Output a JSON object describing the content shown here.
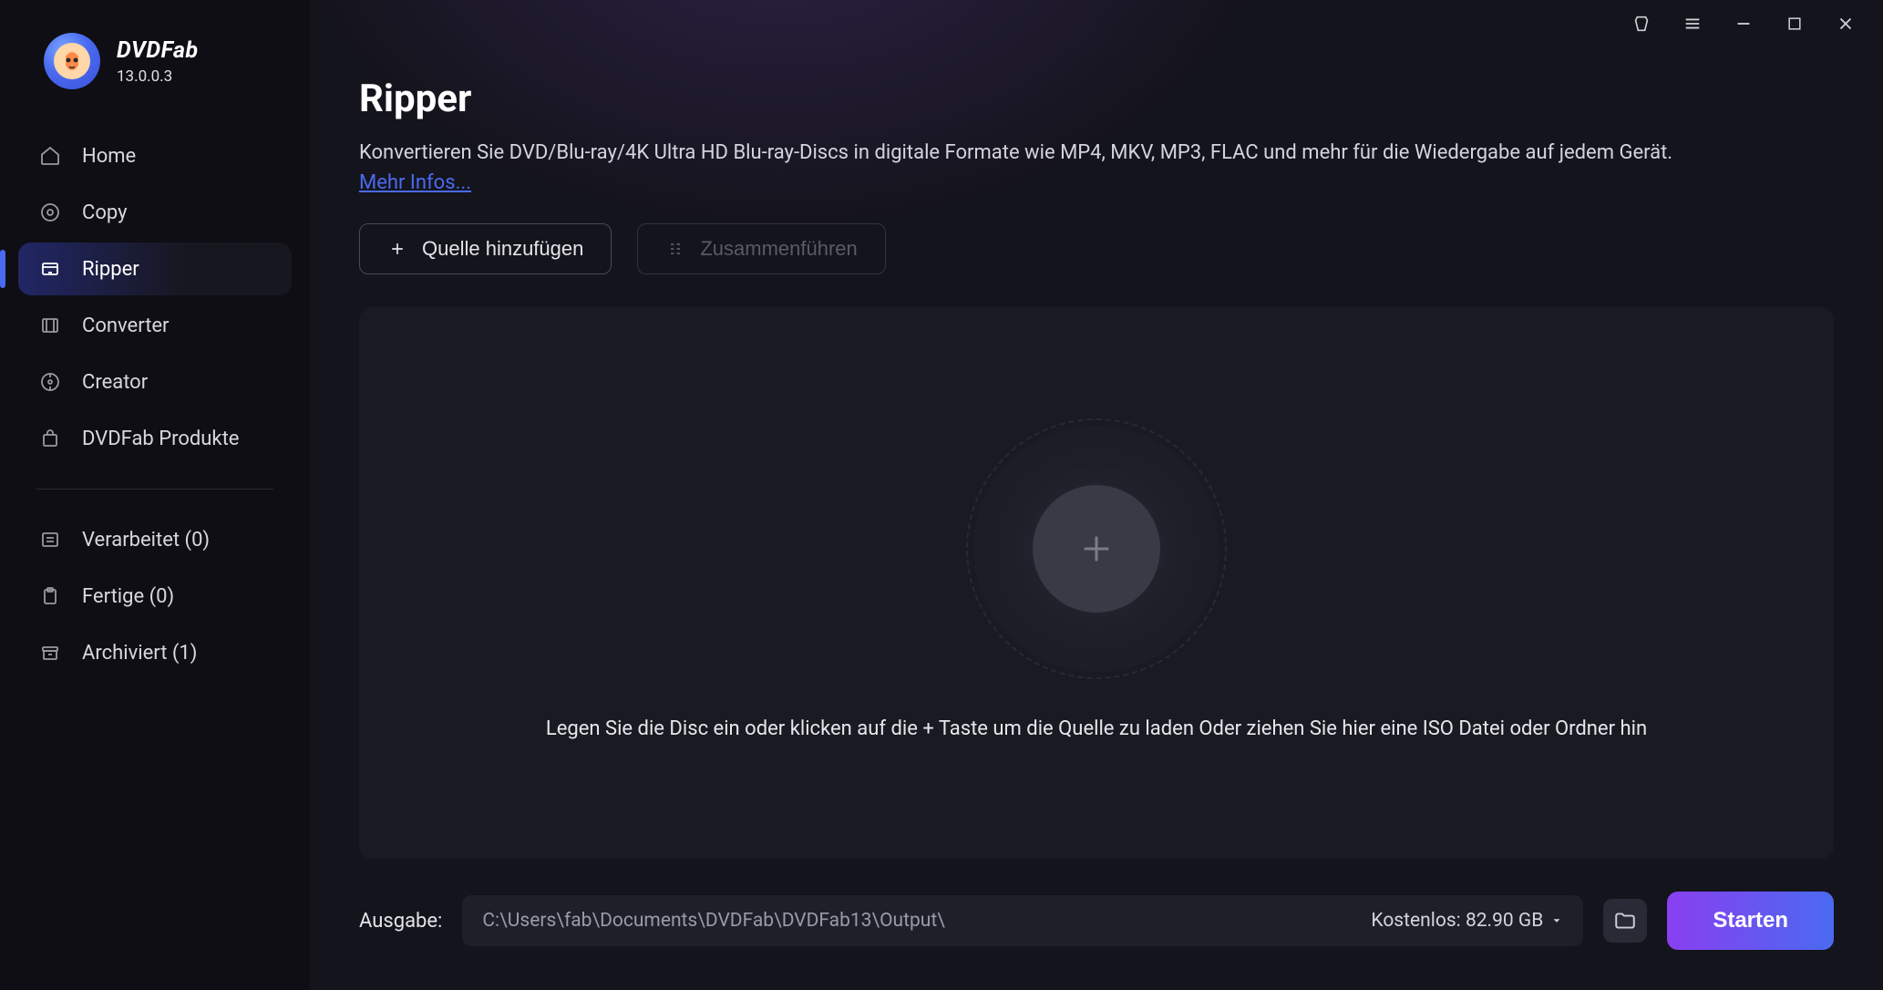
{
  "brand": {
    "name": "DVDFab",
    "version": "13.0.0.3"
  },
  "sidebar": {
    "items": [
      {
        "label": "Home"
      },
      {
        "label": "Copy"
      },
      {
        "label": "Ripper"
      },
      {
        "label": "Converter"
      },
      {
        "label": "Creator"
      },
      {
        "label": "DVDFab Produkte"
      }
    ],
    "status": [
      {
        "label": "Verarbeitet (0)"
      },
      {
        "label": "Fertige (0)"
      },
      {
        "label": "Archiviert (1)"
      }
    ]
  },
  "page": {
    "title": "Ripper",
    "description": "Konvertieren Sie DVD/Blu-ray/4K Ultra HD Blu-ray-Discs in digitale Formate wie MP4, MKV, MP3, FLAC und mehr für die Wiedergabe auf jedem Gerät.",
    "more_link": "Mehr Infos..."
  },
  "actions": {
    "add_source": "Quelle hinzufügen",
    "merge": "Zusammenführen"
  },
  "dropzone": {
    "hint": "Legen Sie die Disc ein oder klicken auf die + Taste um die Quelle zu laden Oder ziehen Sie hier eine ISO Datei oder Ordner hin"
  },
  "footer": {
    "output_label": "Ausgabe:",
    "output_path": "C:\\Users\\fab\\Documents\\DVDFab\\DVDFab13\\Output\\",
    "free_label": "Kostenlos: 82.90 GB",
    "start": "Starten"
  }
}
